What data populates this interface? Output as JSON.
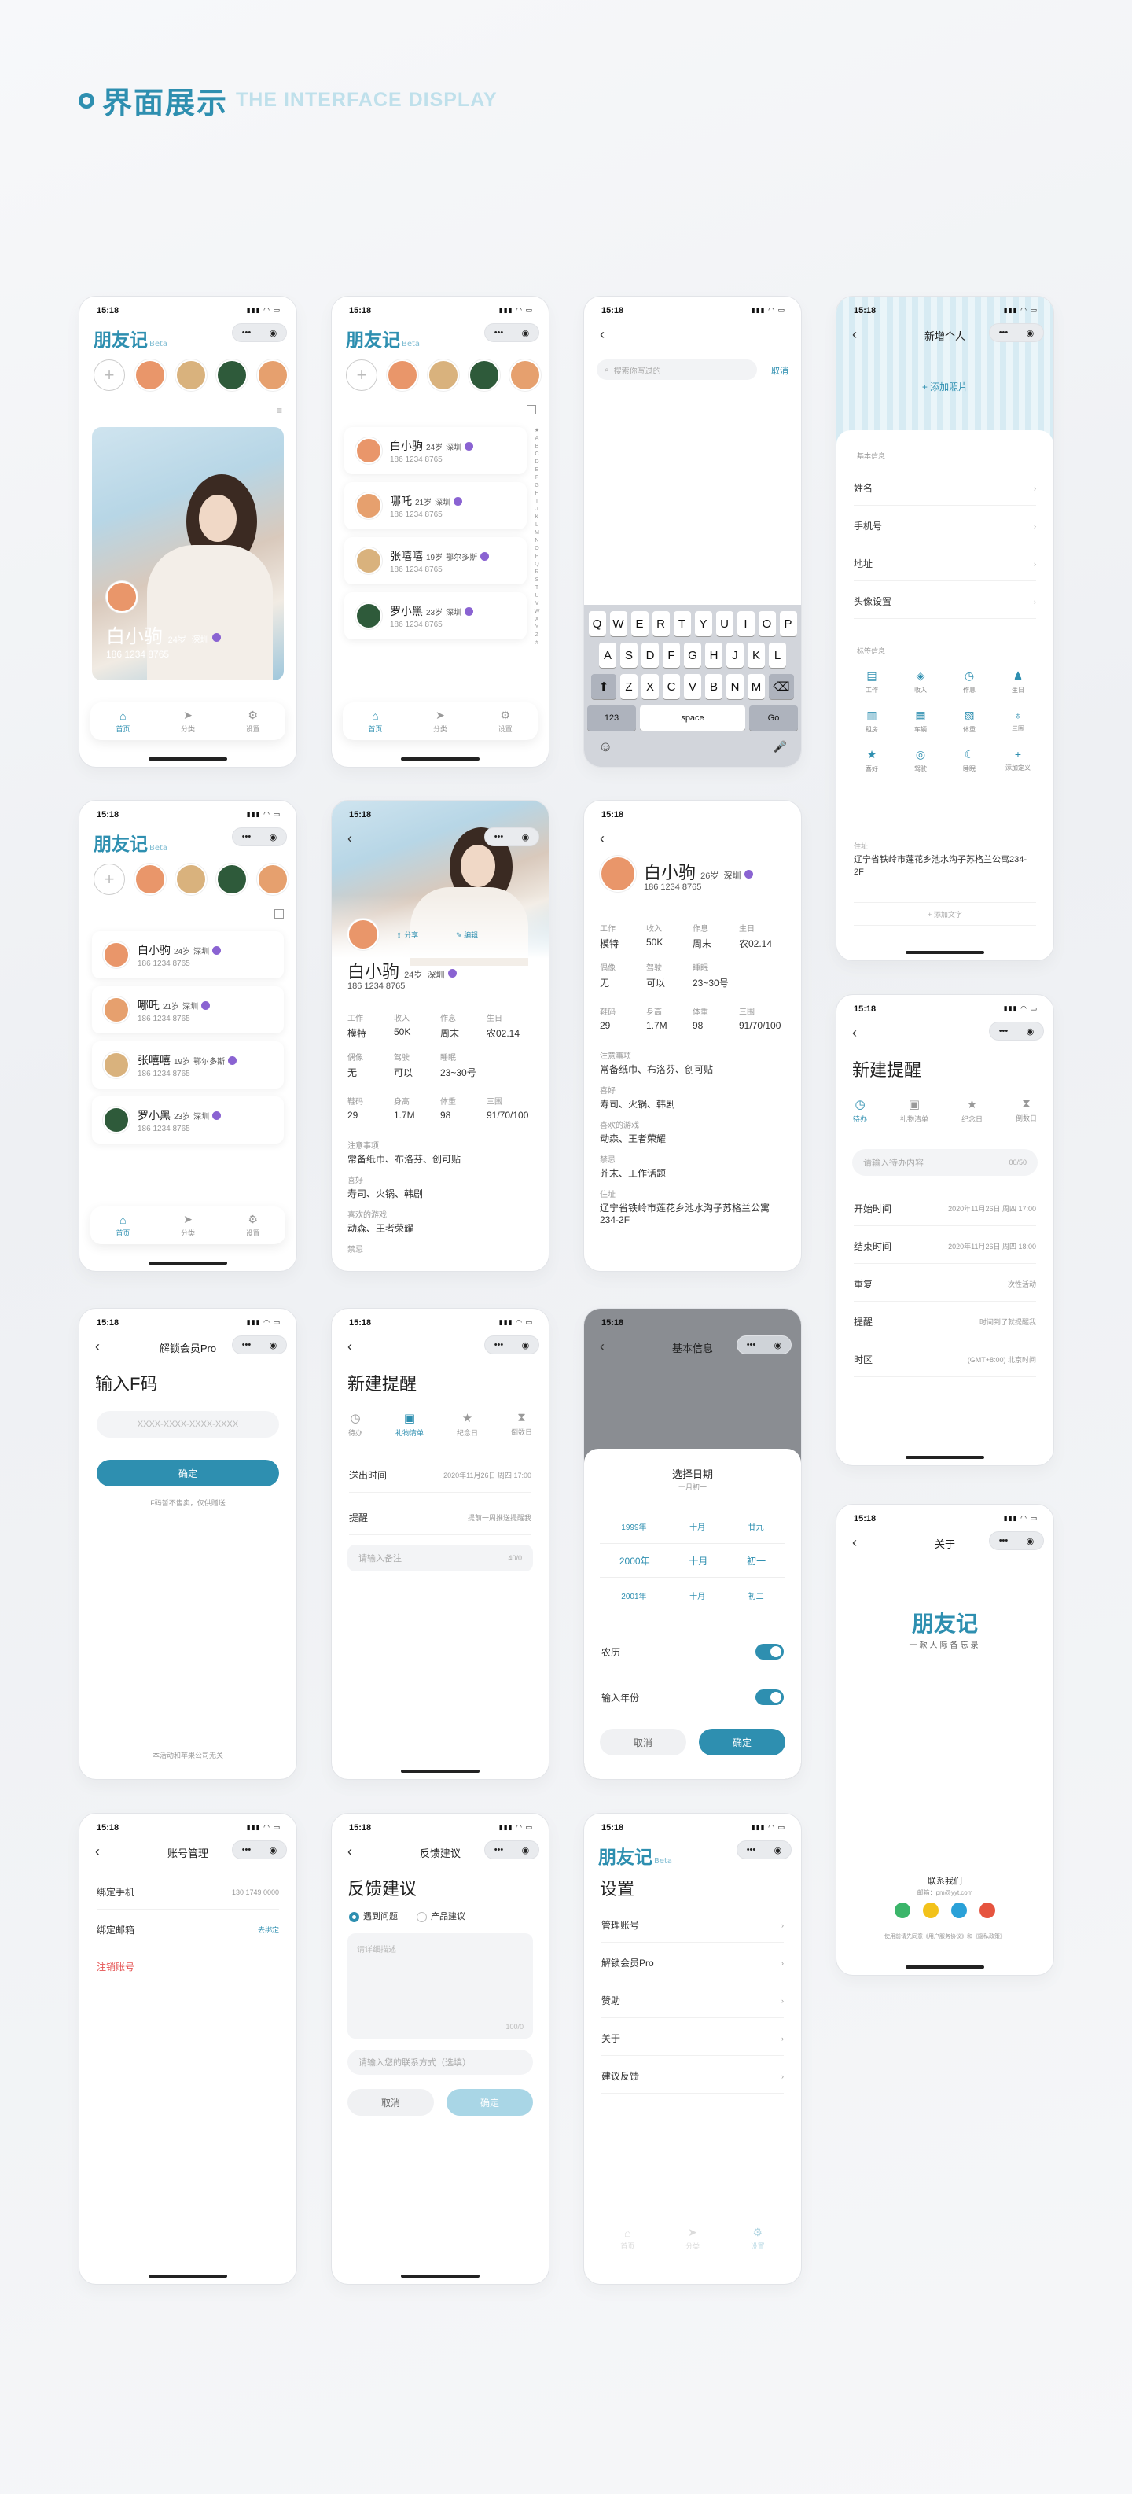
{
  "header": {
    "title_cn": "界面展示",
    "title_en": "THE INTERFACE DISPLAY"
  },
  "common": {
    "time": "15:18",
    "status_icons": "▮▮▮ ◠ ▭",
    "capsule_dots": "•••",
    "capsule_target": "◉",
    "back": "‹",
    "app_name": "朋友记",
    "beta": "Beta",
    "plus": "+",
    "chevron": "›"
  },
  "colors": {
    "accent": "#2e8fb0",
    "vip": "#8a63d2",
    "danger": "#e55353"
  },
  "tabs": [
    {
      "label": "首页",
      "icon": "home-icon"
    },
    {
      "label": "分类",
      "icon": "send-icon"
    },
    {
      "label": "设置",
      "icon": "gear-icon"
    }
  ],
  "tab_glyphs": [
    "⌂",
    "➤",
    "⚙"
  ],
  "contacts": [
    {
      "name": "白小驹",
      "age": "24岁",
      "city": "深圳",
      "phone": "186 1234 8765"
    },
    {
      "name": "哪吒",
      "age": "21岁",
      "city": "深圳",
      "phone": "186 1234 8765"
    },
    {
      "name": "张嘻嘻",
      "age": "19岁",
      "city": "鄂尔多斯",
      "phone": "186 1234 8765"
    },
    {
      "name": "罗小黑",
      "age": "23岁",
      "city": "深圳",
      "phone": "186 1234 8765"
    }
  ],
  "alpha_index": [
    "★",
    "A",
    "B",
    "C",
    "D",
    "E",
    "F",
    "G",
    "H",
    "I",
    "J",
    "K",
    "L",
    "M",
    "N",
    "O",
    "P",
    "Q",
    "R",
    "S",
    "T",
    "U",
    "V",
    "W",
    "X",
    "Y",
    "Z",
    "#"
  ],
  "search": {
    "placeholder": "搜索你写过的",
    "cancel": "取消"
  },
  "keyboard": {
    "row1": [
      "Q",
      "W",
      "E",
      "R",
      "T",
      "Y",
      "U",
      "I",
      "O",
      "P"
    ],
    "row2": [
      "A",
      "S",
      "D",
      "F",
      "G",
      "H",
      "J",
      "K",
      "L"
    ],
    "row3": [
      "Z",
      "X",
      "C",
      "V",
      "B",
      "N",
      "M"
    ],
    "shift": "⬆",
    "delete": "⌫",
    "num": "123",
    "space": "space",
    "go": "Go",
    "emoji": "☺",
    "mic": "🎤"
  },
  "new_person": {
    "title": "新增个人",
    "add_photo": "+ 添加照片",
    "basic_section": "基本信息",
    "fields": [
      "姓名",
      "手机号",
      "地址",
      "头像设置"
    ],
    "tag_section": "标签信息",
    "tags": [
      "工作",
      "收入",
      "作息",
      "生日",
      "租房",
      "车辆",
      "体重",
      "三围",
      "喜好",
      "驾驶",
      "睡眠",
      "添加定义"
    ],
    "tag_glyphs": [
      "▤",
      "◈",
      "◷",
      "♟",
      "▥",
      "▦",
      "▧",
      "♁",
      "★",
      "◎",
      "☾",
      "+"
    ],
    "address_label": "住址",
    "address": "辽宁省铁岭市莲花乡池水沟子苏格兰公寓234-2F",
    "add_text": "+ 添加文字"
  },
  "profile": {
    "name": "白小驹",
    "age": "26岁",
    "city": "深圳",
    "phone": "186 1234 8765",
    "overlay_name": "白小驹",
    "overlay_age": "24岁",
    "overlay_city": "深圳",
    "action_share": "分享",
    "action_edit": "编辑",
    "r1": [
      {
        "k": "工作",
        "v": "模特"
      },
      {
        "k": "收入",
        "v": "50K"
      },
      {
        "k": "作息",
        "v": "周末"
      },
      {
        "k": "生日",
        "v": "农02.14"
      }
    ],
    "r2": [
      {
        "k": "偶像",
        "v": "无"
      },
      {
        "k": "驾驶",
        "v": "可以"
      },
      {
        "k": "睡眠",
        "v": "23~30号"
      }
    ],
    "r3": [
      {
        "k": "鞋码",
        "v": "29"
      },
      {
        "k": "身高",
        "v": "1.7M"
      },
      {
        "k": "体重",
        "v": "98"
      },
      {
        "k": "三围",
        "v": "91/70/100"
      }
    ],
    "notes": [
      {
        "k": "注意事项",
        "v": "常备纸巾、布洛芬、创可贴"
      },
      {
        "k": "喜好",
        "v": "寿司、火锅、韩剧"
      },
      {
        "k": "喜欢的游戏",
        "v": "动森、王者荣耀"
      },
      {
        "k": "禁忌",
        "v": "芥末、工作话题"
      },
      {
        "k": "住址",
        "v": "辽宁省铁岭市莲花乡池水沟子苏格兰公寓234-2F"
      }
    ]
  },
  "reminder": {
    "title": "新建提醒",
    "segs": [
      "待办",
      "礼物清单",
      "纪念日",
      "倒数日"
    ],
    "seg_glyphs": [
      "◷",
      "▣",
      "★",
      "⧗"
    ],
    "todo_placeholder": "请输入待办内容",
    "todo_count": "00/50",
    "rows": [
      {
        "k": "开始时间",
        "v": "2020年11月26日 周四 17:00"
      },
      {
        "k": "结束时间",
        "v": "2020年11月26日 周四 18:00"
      },
      {
        "k": "重复",
        "v": "一次性活动"
      },
      {
        "k": "提醒",
        "v": "时间到了就提醒我"
      },
      {
        "k": "时区",
        "v": "(GMT+8:00) 北京时间"
      }
    ],
    "gift_rows": [
      {
        "k": "送出时间",
        "v": "2020年11月26日 周四 17:00"
      },
      {
        "k": "提醒",
        "v": "提前一周推送提醒我"
      }
    ],
    "note_placeholder": "请输入备注",
    "note_count": "40/0"
  },
  "fcode": {
    "title": "解锁会员Pro",
    "heading": "输入F码",
    "placeholder": "XXXX-XXXX-XXXX-XXXX",
    "confirm": "确定",
    "hint": "F码暂不售卖，仅供赠送",
    "footer": "本活动和苹果公司无关"
  },
  "date_picker": {
    "bg_title": "基本信息",
    "title": "选择日期",
    "subtitle": "十月初一",
    "years": [
      "1999年",
      "2000年",
      "2001年"
    ],
    "months": [
      "十月",
      "十月",
      "十月"
    ],
    "days": [
      "廿九",
      "初一",
      "初二"
    ],
    "lunar": "农历",
    "input_year": "输入年份",
    "cancel": "取消",
    "confirm": "确定"
  },
  "about": {
    "title": "关于",
    "app": "朋友记",
    "slogan": "一款人际备忘录",
    "contact": "联系我们",
    "email": "邮箱：pm@yyt.com",
    "agreement": "使用前请先同意《用户服务协议》和《隐私政策》"
  },
  "account": {
    "title": "账号管理",
    "rows": [
      {
        "k": "绑定手机",
        "v": "130 1749 0000"
      },
      {
        "k": "绑定邮箱",
        "v": "去绑定"
      }
    ],
    "logout": "注销账号"
  },
  "feedback": {
    "title": "反馈建议",
    "heading": "反馈建议",
    "opt1": "遇到问题",
    "opt2": "产品建议",
    "placeholder": "请详细描述",
    "count": "100/0",
    "contact_placeholder": "请输入您的联系方式（选填）",
    "cancel": "取消",
    "submit": "确定"
  },
  "settings": {
    "heading": "设置",
    "items": [
      "管理账号",
      "解锁会员Pro",
      "赞助",
      "关于",
      "建议反馈"
    ]
  }
}
